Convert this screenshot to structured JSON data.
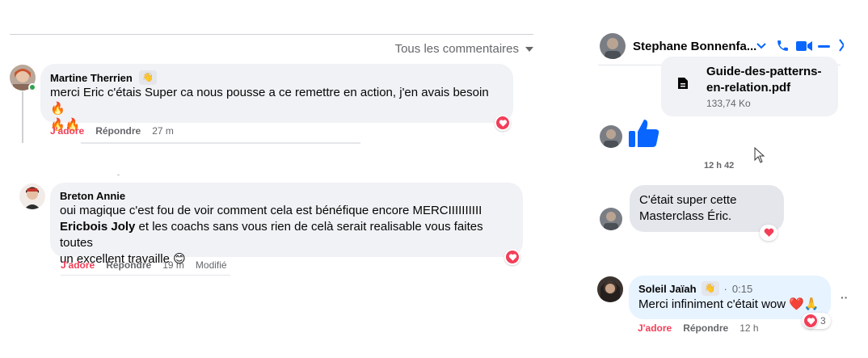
{
  "comments_panel": {
    "filter_label": "Tous les commentaires",
    "comments": [
      {
        "author": "Martine Therrien",
        "text_line1": "merci Eric c'étais Super ca nous pousse a ce remettre en action, j'en avais besoin🔥",
        "text_line2": "🔥🔥",
        "love_label": "J'adore",
        "reply_label": "Répondre",
        "time": "27 m"
      },
      {
        "author": "Breton Annie",
        "text_line1": "oui magique c'est fou de voir comment cela est bénéfique encore MERCIIIIIIIIII",
        "mention": "Ericbois Joly",
        "text_line2": " et les coachs sans vous rien de celà serait realisable vous faites toutes",
        "text_line3": "un excellent travaille 😊",
        "love_label": "J'adore",
        "reply_label": "Répondre",
        "time": "19 m",
        "edited_label": "Modifié"
      }
    ]
  },
  "messenger": {
    "contact_name": "Stephane Bonnenfa...",
    "file": {
      "name_line1": "Guide-des-patterns-",
      "name_line2": "en-relation.pdf",
      "size": "133,74 Ko"
    },
    "timestamp": "12 h 42",
    "message": {
      "line1": "C'était super cette",
      "line2": "Masterclass Éric."
    },
    "comment": {
      "author": "Soleil Jaïah",
      "time": "0:15",
      "text": "Merci infiniment c'était wow ❤️🙏",
      "love_label": "J'adore",
      "reply_label": "Répondre",
      "age": "12 h",
      "reaction_count": "3",
      "more_label": "··"
    }
  },
  "colors": {
    "love": "#f33e58",
    "messenger_blue": "#0866ff",
    "bubble": "#f0f2f5"
  }
}
